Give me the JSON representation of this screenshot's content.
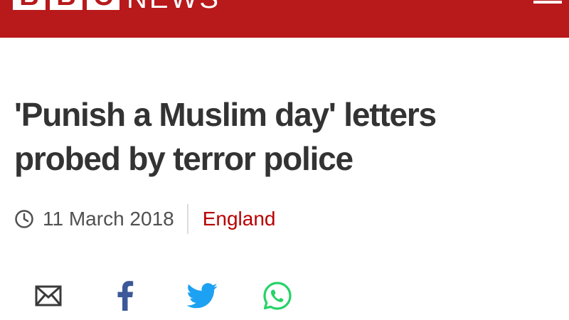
{
  "header": {
    "logo_letters": [
      "B",
      "B",
      "C"
    ],
    "brand_word": "NEWS",
    "menu_icon": "hamburger-menu-icon",
    "background_color": "#b8191a"
  },
  "article": {
    "headline_line1": "'Punish a Muslim day' letters",
    "headline_line2": "probed by terror police",
    "date": "11 March 2018",
    "date_icon": "clock-icon",
    "section": "England",
    "section_color": "#b80000"
  },
  "share": {
    "icons": [
      "email-icon",
      "facebook-icon",
      "twitter-icon",
      "whatsapp-icon"
    ],
    "colors": {
      "email": "#3a3a3a",
      "facebook": "#3b5998",
      "twitter": "#1da1f2",
      "whatsapp": "#25d366"
    }
  }
}
